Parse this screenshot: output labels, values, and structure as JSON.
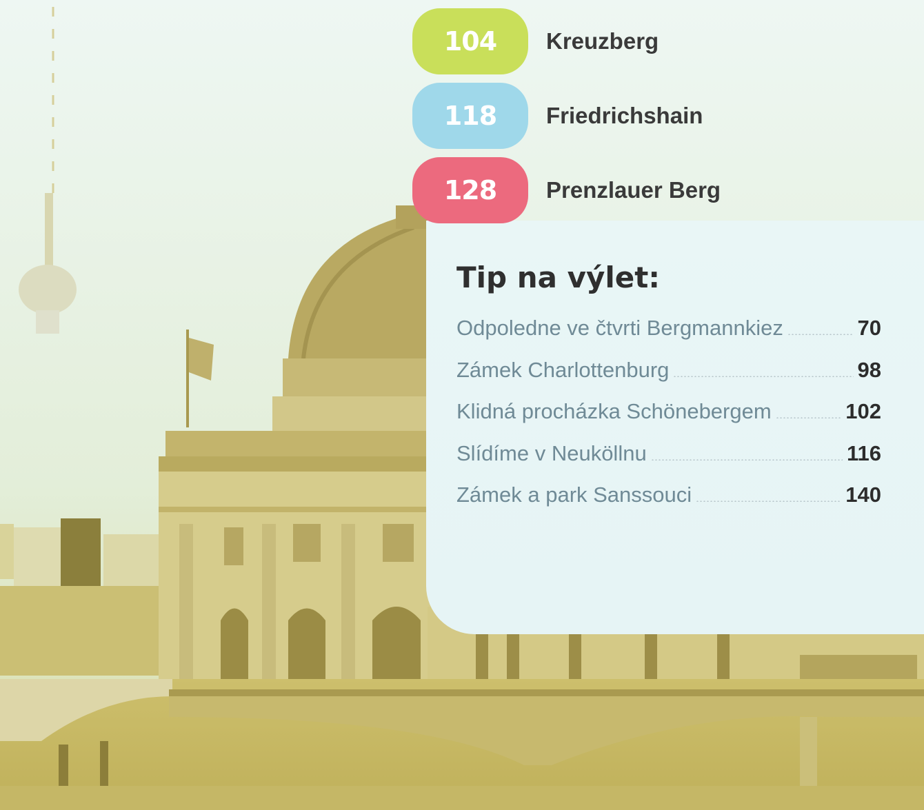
{
  "colors": {
    "kreuzberg": "#c9df5a",
    "friedrichshain": "#9fd8ea",
    "prenzlauer": "#ec6a7e",
    "sepia": "#cfc374"
  },
  "districts": [
    {
      "page": "104",
      "name": "Kreuzberg"
    },
    {
      "page": "118",
      "name": "Friedrichshain"
    },
    {
      "page": "128",
      "name": "Prenzlauer Berg"
    }
  ],
  "tips": {
    "heading": "Tip na výlet:",
    "items": [
      {
        "title": "Odpoledne ve čtvrti Bergmannkiez",
        "page": "70"
      },
      {
        "title": "Zámek Charlottenburg",
        "page": "98"
      },
      {
        "title": "Klidná procházka Schönebergem",
        "page": "102"
      },
      {
        "title": "Slídíme v Neuköllnu",
        "page": "116"
      },
      {
        "title": "Zámek a park Sanssouci",
        "page": "140"
      }
    ]
  },
  "background_photo": {
    "subject": "bode-museum-and-tv-tower-icon",
    "tone": "sepia"
  }
}
